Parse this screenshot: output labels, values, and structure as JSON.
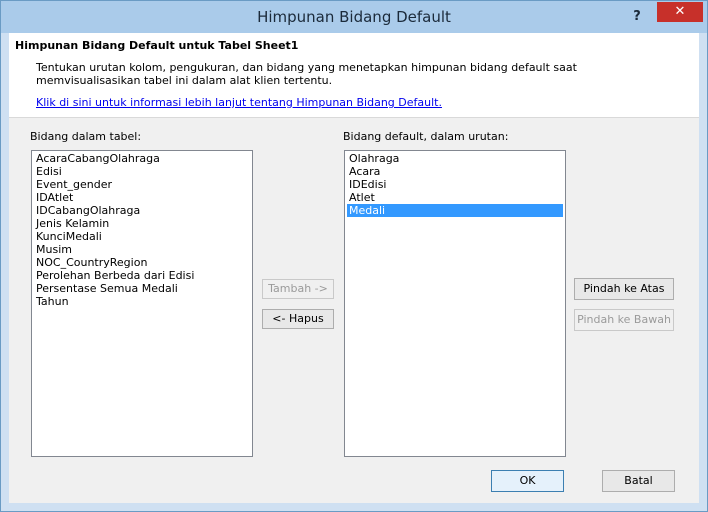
{
  "window": {
    "title": "Himpunan Bidang Default",
    "help_label": "?",
    "close_label": "✕"
  },
  "header": {
    "title": "Himpunan Bidang Default untuk Tabel Sheet1",
    "description": "Tentukan urutan kolom, pengukuran, dan bidang yang menetapkan himpunan bidang default saat memvisualisasikan tabel ini dalam alat klien tertentu.",
    "link": "Klik di sini untuk informasi lebih lanjut tentang Himpunan Bidang Default."
  },
  "left_list": {
    "label": "Bidang dalam tabel:",
    "items": [
      "AcaraCabangOlahraga",
      "Edisi",
      "Event_gender",
      "IDAtlet",
      "IDCabangOlahraga",
      "Jenis Kelamin",
      "KunciMedali",
      "Musim",
      "NOC_CountryRegion",
      "Perolehan Berbeda dari Edisi",
      "Persentase Semua Medali",
      "Tahun"
    ]
  },
  "right_list": {
    "label": "Bidang default, dalam urutan:",
    "items": [
      "Olahraga",
      "Acara",
      "IDEdisi",
      "Atlet",
      "Medali"
    ],
    "selected_index": 4
  },
  "buttons": {
    "add": "Tambah ->",
    "remove": "<- Hapus",
    "move_up": "Pindah ke Atas",
    "move_down": "Pindah ke Bawah",
    "ok": "OK",
    "cancel": "Batal"
  },
  "colors": {
    "selection": "#3399ff",
    "close_button": "#c7302a",
    "titlebar": "#aacbea"
  }
}
